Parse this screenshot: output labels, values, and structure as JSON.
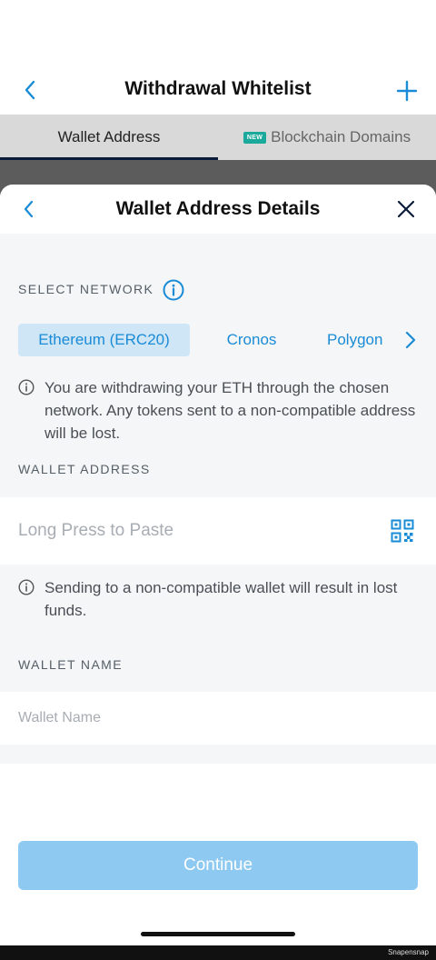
{
  "header": {
    "title": "Withdrawal Whitelist"
  },
  "tabs": [
    {
      "label": "Wallet Address",
      "active": true
    },
    {
      "label": "Blockchain Domains",
      "badge": "NEW",
      "active": false
    }
  ],
  "sheet": {
    "title": "Wallet Address Details",
    "select_network_label": "SELECT NETWORK",
    "networks": [
      {
        "label": "Ethereum (ERC20)",
        "selected": true
      },
      {
        "label": "Cronos",
        "selected": false
      },
      {
        "label": "Polygon",
        "selected": false
      }
    ],
    "network_note": "You are withdrawing your ETH through the chosen network. Any tokens sent to a non-compatible address will be lost.",
    "wallet_address_label": "WALLET ADDRESS",
    "wallet_address_placeholder": "Long Press to Paste",
    "wallet_address_value": "",
    "address_note": "Sending to a non-compatible wallet will result in lost funds.",
    "wallet_name_label": "WALLET NAME",
    "wallet_name_placeholder": "Wallet Name",
    "wallet_name_value": "",
    "continue_label": "Continue"
  },
  "footer": {
    "watermark": "Snapensnap"
  },
  "colors": {
    "accent": "#1a8bd6",
    "chip_selected_bg": "#cfe6f7",
    "button_disabled": "#8ec9f2",
    "new_badge": "#1aa99b",
    "tab_indicator": "#0b1c3a"
  },
  "icons": {
    "back": "chevron-left-icon",
    "add": "plus-icon",
    "close": "close-icon",
    "info": "info-icon",
    "next": "chevron-right-icon",
    "qr": "qr-code-icon"
  }
}
